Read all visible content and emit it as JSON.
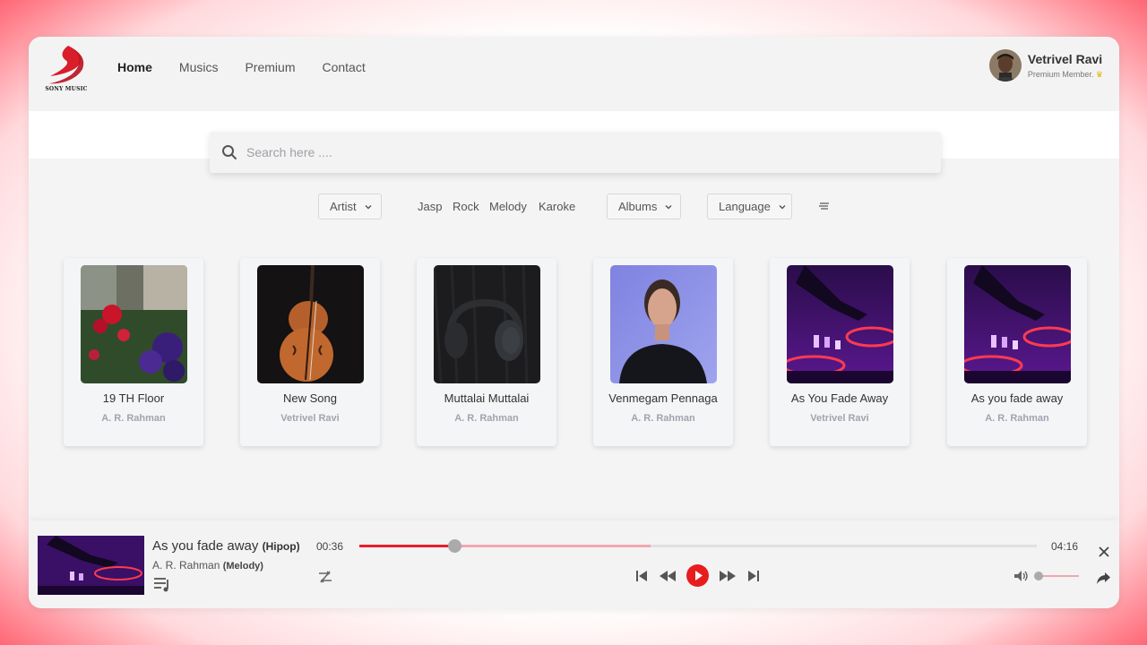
{
  "brand": {
    "logo_text": "SONY MUSIC",
    "accent": "#e81c1c"
  },
  "nav": {
    "items": [
      "Home",
      "Musics",
      "Premium",
      "Contact"
    ],
    "active": "Home"
  },
  "user": {
    "name": "Vetrivel Ravi",
    "membership": "Premium Member."
  },
  "search": {
    "placeholder": "Search here ....",
    "value": ""
  },
  "filters": {
    "artist": "Artist",
    "genres": [
      "Jasp",
      "Rock",
      "Melody",
      "Karoke"
    ],
    "albums": "Albums",
    "language": "Language"
  },
  "songs": [
    {
      "title": "19 TH Floor",
      "artist": "A. R. Rahman"
    },
    {
      "title": "New Song",
      "artist": "Vetrivel Ravi"
    },
    {
      "title": "Muttalai Muttalai",
      "artist": "A. R. Rahman"
    },
    {
      "title": "Venmegam Pennaga",
      "artist": "A. R. Rahman"
    },
    {
      "title": "As You Fade Away",
      "artist": "Vetrivel Ravi"
    },
    {
      "title": "As you fade away",
      "artist": "A. R. Rahman"
    }
  ],
  "player": {
    "title": "As you fade away",
    "genre": "(Hipop)",
    "artist": "A. R. Rahman",
    "album": "(Melody)",
    "elapsed": "00:36",
    "duration": "04:16",
    "progress_fraction": 0.14,
    "buffered_fraction": 0.43,
    "volume_fraction": 0.0
  }
}
